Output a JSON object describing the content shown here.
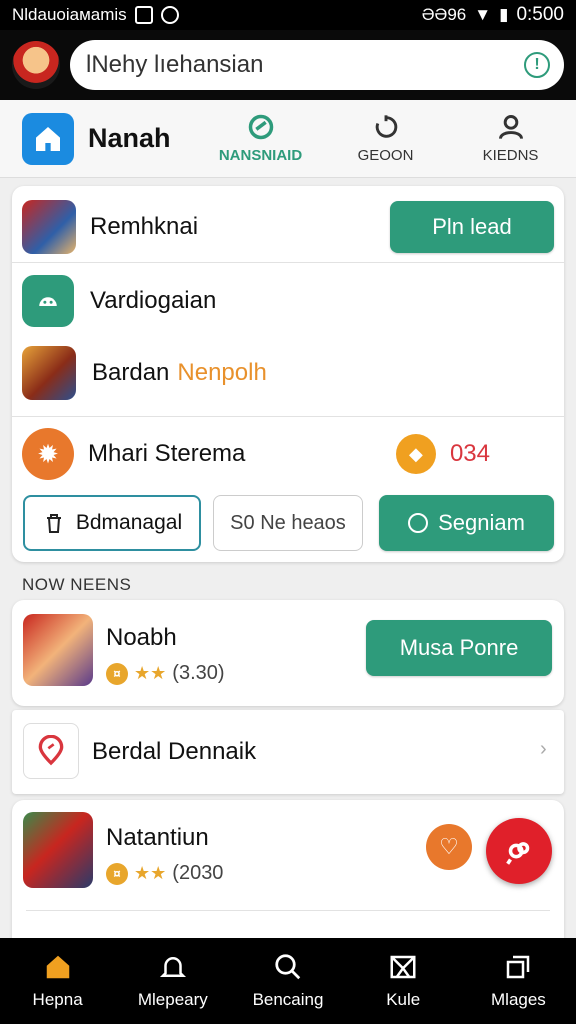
{
  "status": {
    "carrier": "Nldauoiaмamis",
    "time": "0:500",
    "signal_text": "ƏӘ96"
  },
  "search": {
    "value": "lNehy lıehansian"
  },
  "topnav": {
    "brand": "Nanah",
    "tabs": [
      {
        "label": "NANSNIAID",
        "icon": "leaf-icon",
        "active": true
      },
      {
        "label": "GEOON",
        "icon": "refresh-icon",
        "active": false
      },
      {
        "label": "KIEDNS",
        "icon": "person-icon",
        "active": false
      }
    ]
  },
  "card1": {
    "row1": {
      "label": "Remhknai",
      "button": "Pln lead"
    },
    "row2": {
      "label": "Vardiogaian"
    },
    "row3": {
      "label": "Bardan",
      "highlight": "Nenpolh"
    },
    "row4": {
      "label": "Mhari Sterema",
      "count": "034"
    },
    "actions": {
      "a": "Bdmanagal",
      "b": "S0 Ne heaos",
      "c": "Segniam"
    }
  },
  "section": {
    "title": "NOW NEENS"
  },
  "list": [
    {
      "title": "Noabh",
      "rating": "(3.30)",
      "button": "Musa Ponre"
    },
    {
      "title": "Berdal Dennaik"
    },
    {
      "title": "Natantiun",
      "rating": "(2030"
    }
  ],
  "bottomnav": [
    {
      "label": "Hepna",
      "icon": "home-icon"
    },
    {
      "label": "Mlepeary",
      "icon": "bell-icon"
    },
    {
      "label": "Bencaing",
      "icon": "search-icon"
    },
    {
      "label": "Kule",
      "icon": "book-icon"
    },
    {
      "label": "Mlages",
      "icon": "windows-icon"
    }
  ],
  "colors": {
    "accent": "#2e9b7b",
    "brand_blue": "#1b8be0",
    "orange": "#e8782c",
    "fab_red": "#e0202a"
  }
}
